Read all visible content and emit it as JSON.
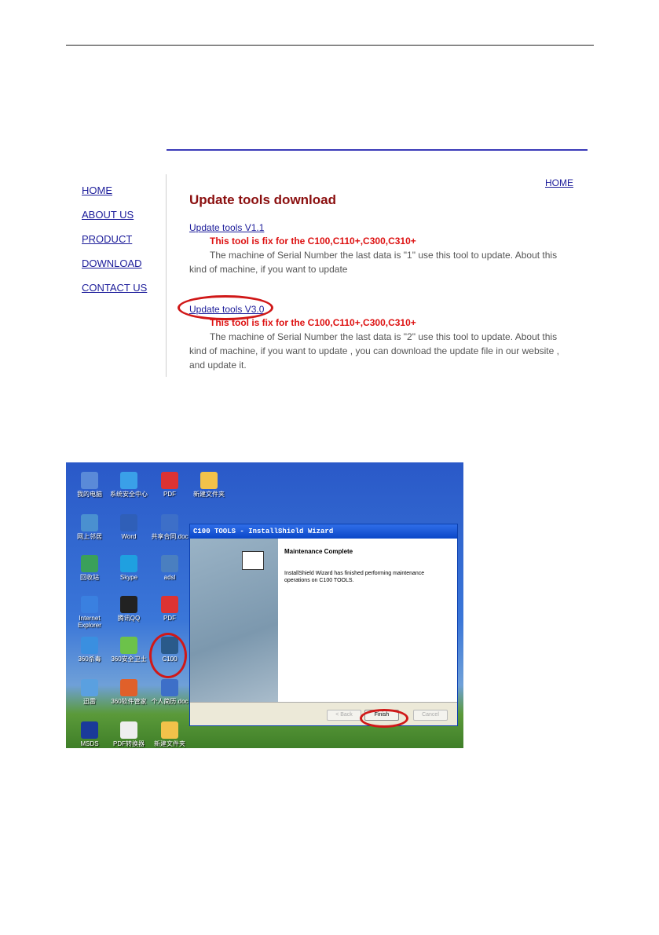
{
  "website": {
    "nav": [
      "HOME",
      "ABOUT US",
      "PRODUCT",
      "DOWNLOAD",
      "CONTACT US"
    ],
    "home_link": "HOME",
    "title": "Update tools download",
    "items": [
      {
        "link": "Update tools V1.1",
        "note": "This tool is fix for the C100,C110+,C300,C310+",
        "desc": "The machine of Serial Number the last data is \"1\" use this tool to update. About this kind of machine, if you want to update"
      },
      {
        "link": "Update tools V3.0",
        "note": "This tool is fix for the C100,C110+,C300,C310+",
        "desc": "The machine of Serial Number the last data is \"2\" use this tool to update. About this kind of machine, if you want to update , you can download the update file in our website , and update it."
      }
    ]
  },
  "desktop": {
    "icons": [
      {
        "label": "我的电脑",
        "color": "#5a8ad8"
      },
      {
        "label": "系统安全中心",
        "color": "#3aa0e8"
      },
      {
        "label": "PDF",
        "color": "#d33"
      },
      {
        "label": "新建文件夹",
        "color": "#f2c24a"
      },
      {
        "label": "网上邻居",
        "color": "#4a90d0"
      },
      {
        "label": "Word",
        "color": "#2f5fb8"
      },
      {
        "label": "共享合同.doc",
        "color": "#3d6fc8"
      },
      {
        "label": "回收站",
        "color": "#3aa05a"
      },
      {
        "label": "Skype",
        "color": "#1fa0e0"
      },
      {
        "label": "adsl",
        "color": "#4a7fc0"
      },
      {
        "label": "Internet Explorer",
        "color": "#3a80e0"
      },
      {
        "label": "腾讯QQ",
        "color": "#222"
      },
      {
        "label": "PDF",
        "color": "#d33"
      },
      {
        "label": "360杀毒",
        "color": "#3a8fe0"
      },
      {
        "label": "360安全卫士",
        "color": "#6cc24a"
      },
      {
        "label": "C100",
        "color": "#2a5a8a"
      },
      {
        "label": "迅雷",
        "color": "#5aa0e0"
      },
      {
        "label": "360软件管家",
        "color": "#e0602a"
      },
      {
        "label": "个人简历.doc",
        "color": "#3d6fc8"
      },
      {
        "label": "MSDS",
        "color": "#1a3a9a"
      },
      {
        "label": "PDF转换器",
        "color": "#eee"
      },
      {
        "label": "新建文件夹",
        "color": "#f2c24a"
      }
    ],
    "wizard": {
      "title": "C100 TOOLS - InstallShield Wizard",
      "heading": "Maintenance Complete",
      "body": "InstallShield Wizard has finished performing maintenance operations on C100 TOOLS.",
      "back": "< Back",
      "finish": "Finish",
      "cancel": "Cancel"
    }
  }
}
